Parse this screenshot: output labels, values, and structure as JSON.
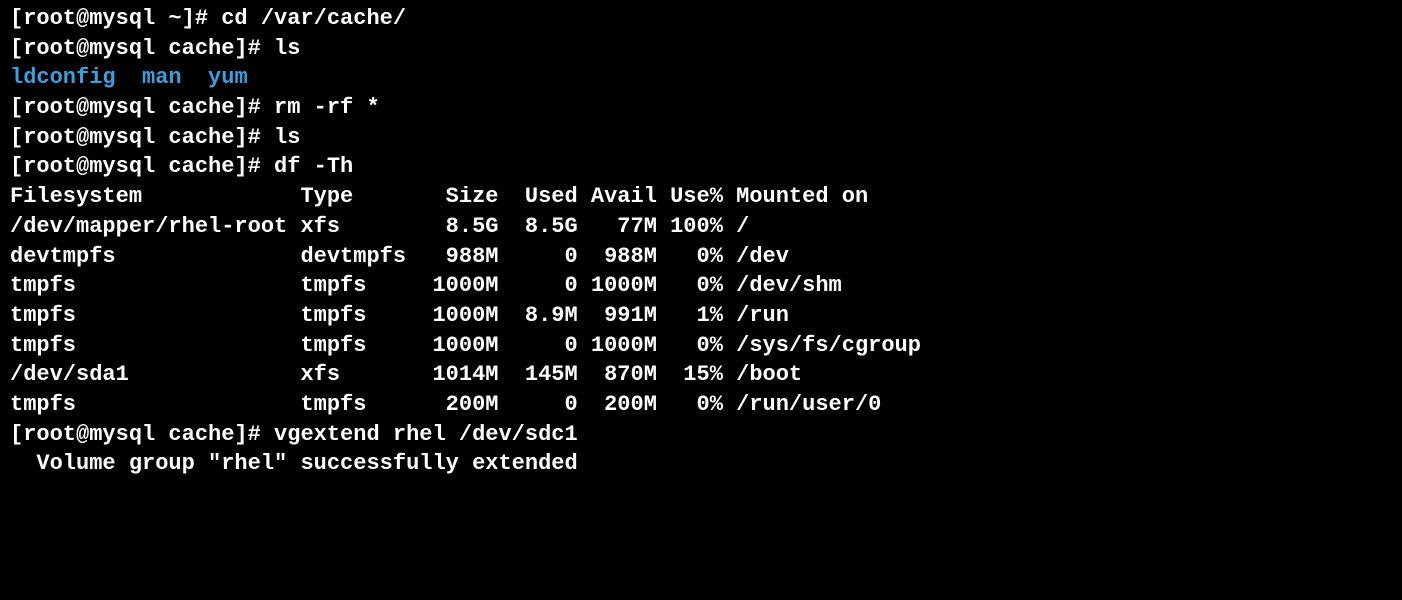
{
  "lines": [
    {
      "prompt": "[root@mysql ~]# ",
      "cmd": "cd /var/cache/"
    },
    {
      "prompt": "[root@mysql cache]# ",
      "cmd": "ls"
    },
    {
      "dirs": [
        "ldconfig",
        "man",
        "yum"
      ]
    },
    {
      "prompt": "[root@mysql cache]# ",
      "cmd": "rm -rf *"
    },
    {
      "prompt": "[root@mysql cache]# ",
      "cmd": "ls"
    },
    {
      "prompt": "[root@mysql cache]# ",
      "cmd": "df -Th"
    }
  ],
  "df_header": {
    "filesystem": "Filesystem",
    "type": "Type",
    "size": "Size",
    "used": "Used",
    "avail": "Avail",
    "usep": "Use%",
    "mounted": "Mounted on"
  },
  "df_rows": [
    {
      "filesystem": "/dev/mapper/rhel-root",
      "type": "xfs",
      "size": "8.5G",
      "used": "8.5G",
      "avail": "77M",
      "usep": "100%",
      "mounted": "/"
    },
    {
      "filesystem": "devtmpfs",
      "type": "devtmpfs",
      "size": "988M",
      "used": "0",
      "avail": "988M",
      "usep": "0%",
      "mounted": "/dev"
    },
    {
      "filesystem": "tmpfs",
      "type": "tmpfs",
      "size": "1000M",
      "used": "0",
      "avail": "1000M",
      "usep": "0%",
      "mounted": "/dev/shm"
    },
    {
      "filesystem": "tmpfs",
      "type": "tmpfs",
      "size": "1000M",
      "used": "8.9M",
      "avail": "991M",
      "usep": "1%",
      "mounted": "/run"
    },
    {
      "filesystem": "tmpfs",
      "type": "tmpfs",
      "size": "1000M",
      "used": "0",
      "avail": "1000M",
      "usep": "0%",
      "mounted": "/sys/fs/cgroup"
    },
    {
      "filesystem": "/dev/sda1",
      "type": "xfs",
      "size": "1014M",
      "used": "145M",
      "avail": "870M",
      "usep": "15%",
      "mounted": "/boot"
    },
    {
      "filesystem": "tmpfs",
      "type": "tmpfs",
      "size": "200M",
      "used": "0",
      "avail": "200M",
      "usep": "0%",
      "mounted": "/run/user/0"
    }
  ],
  "vgextend": {
    "prompt": "[root@mysql cache]# ",
    "cmd": "vgextend rhel /dev/sdc1",
    "result": "  Volume group \"rhel\" successfully extended"
  }
}
